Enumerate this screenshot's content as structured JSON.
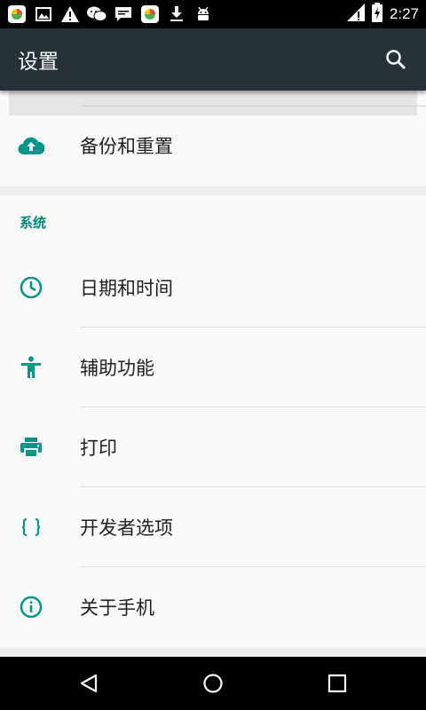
{
  "status_bar": {
    "time": "2:27",
    "notification_icons": [
      "app-icon",
      "image-icon",
      "warning-icon",
      "wechat-icon",
      "message-icon",
      "app-icon",
      "download-icon",
      "android-icon"
    ],
    "system_icons": [
      "wifi-icon",
      "battery-charging-icon"
    ]
  },
  "toolbar": {
    "title": "设置",
    "search_icon": "search-icon"
  },
  "top_section": {
    "items": [
      {
        "label": "备份和重置",
        "icon": "cloud-upload-icon"
      }
    ]
  },
  "system_section": {
    "header": "系统",
    "items": [
      {
        "label": "日期和时间",
        "icon": "clock-icon"
      },
      {
        "label": "辅助功能",
        "icon": "accessibility-icon"
      },
      {
        "label": "打印",
        "icon": "printer-icon"
      },
      {
        "label": "开发者选项",
        "icon": "braces-icon"
      },
      {
        "label": "关于手机",
        "icon": "info-icon"
      }
    ]
  },
  "nav_bar": {
    "buttons": [
      "back-icon",
      "home-icon",
      "recents-icon"
    ]
  },
  "colors": {
    "accent": "#009688",
    "toolbar": "#263238",
    "status_bar": "#000000"
  }
}
